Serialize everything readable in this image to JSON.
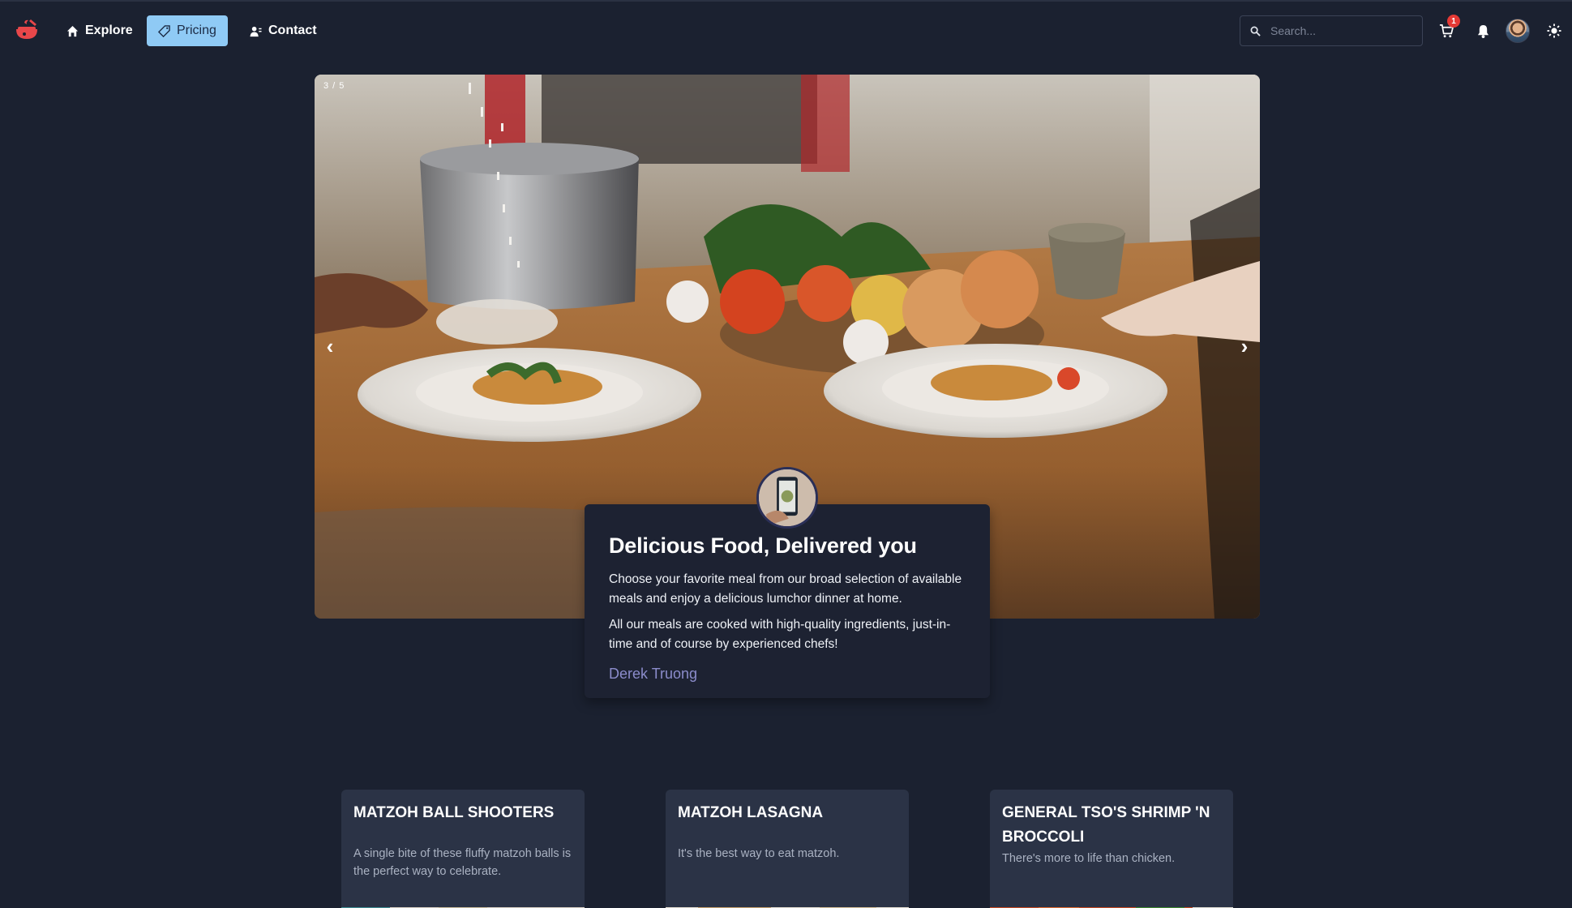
{
  "nav": {
    "items": [
      {
        "label": "Explore",
        "icon": "home-icon",
        "active": false
      },
      {
        "label": "Pricing",
        "icon": "tag-icon",
        "active": true
      },
      {
        "label": "Contact",
        "icon": "contact-icon",
        "active": false
      }
    ],
    "search_placeholder": "Search...",
    "cart_count": "1"
  },
  "hero": {
    "slide_counter": "3 / 5",
    "prev_arrow": "‹",
    "next_arrow": "›"
  },
  "testimonial": {
    "title": "Delicious Food, Delivered you",
    "paragraph_1": "Choose your favorite meal from our broad selection of available meals and enjoy a delicious lumchor dinner at home.",
    "paragraph_2": "All our meals are cooked with high-quality ingredients, just-in-time and of course by experienced chefs!",
    "author": "Derek Truong"
  },
  "products": [
    {
      "title": "MATZOH BALL SHOOTERS",
      "description": "A single bite of these fluffy matzoh balls is the perfect way to celebrate."
    },
    {
      "title": "MATZOH LASAGNA",
      "description": "It's the best way to eat matzoh."
    },
    {
      "title": "GENERAL TSO'S SHRIMP 'N BROCCOLI",
      "description": "There's more to life than chicken."
    }
  ],
  "colors": {
    "background": "#1b2130",
    "active_nav": "#8fcaf5",
    "card": "#1d2232",
    "product_card": "#2b3346",
    "author": "#8b8ccb",
    "badge": "#e53935"
  }
}
